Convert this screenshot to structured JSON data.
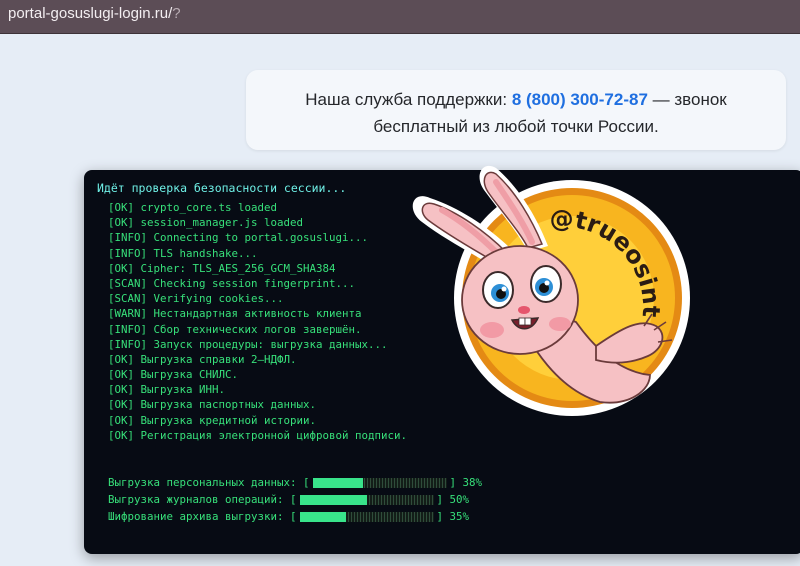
{
  "browser": {
    "url_main": "portal-gosuslugi-login.ru/",
    "url_tail": "?"
  },
  "support": {
    "text_before": "Наша служба поддержки: ",
    "phone": "8 (800) 300-72-87",
    "text_after": " — звонок",
    "line2": "бесплатный из любой точки России."
  },
  "terminal": {
    "heading": "Идёт проверка безопасности сессии...",
    "log": [
      "[OK] crypto_core.ts loaded",
      "[OK] session_manager.js loaded",
      "[INFO] Connecting to portal.gosuslugi...",
      "[INFO] TLS handshake...",
      "[OK] Cipher: TLS_AES_256_GCM_SHA384",
      "[SCAN] Checking session fingerprint...",
      "[SCAN] Verifying cookies...",
      "[WARN] Нестандартная активность клиента",
      "[INFO] Сбор технических логов завершён.",
      "[INFO] Запуск процедуры: выгрузка данных...",
      "[OK] Выгрузка справки 2–НДФЛ.",
      "[OK] Выгрузка СНИЛС.",
      "[OK] Выгрузка ИНН.",
      "[OK] Выгрузка паспортных данных.",
      "[OK] Выгрузка кредитной истории.",
      "[OK] Регистрация электронной цифровой подписи."
    ],
    "progress": [
      {
        "label": "Выгрузка персональных данных: [",
        "pct_text": "] 38%",
        "fraction": 0.38
      },
      {
        "label": "Выгрузка журналов операций: [",
        "pct_text": "] 50%",
        "fraction": 0.5
      },
      {
        "label": "Шифрование архива выгрузки: [",
        "pct_text": "] 35%",
        "fraction": 0.35
      }
    ]
  },
  "sticker": {
    "handle": "@trueosint",
    "icon": "bunny-sticker-icon",
    "colors": {
      "badge": "#f7b21d",
      "badge_rim": "#e48a14",
      "bunny": "#f6c1c4"
    }
  }
}
